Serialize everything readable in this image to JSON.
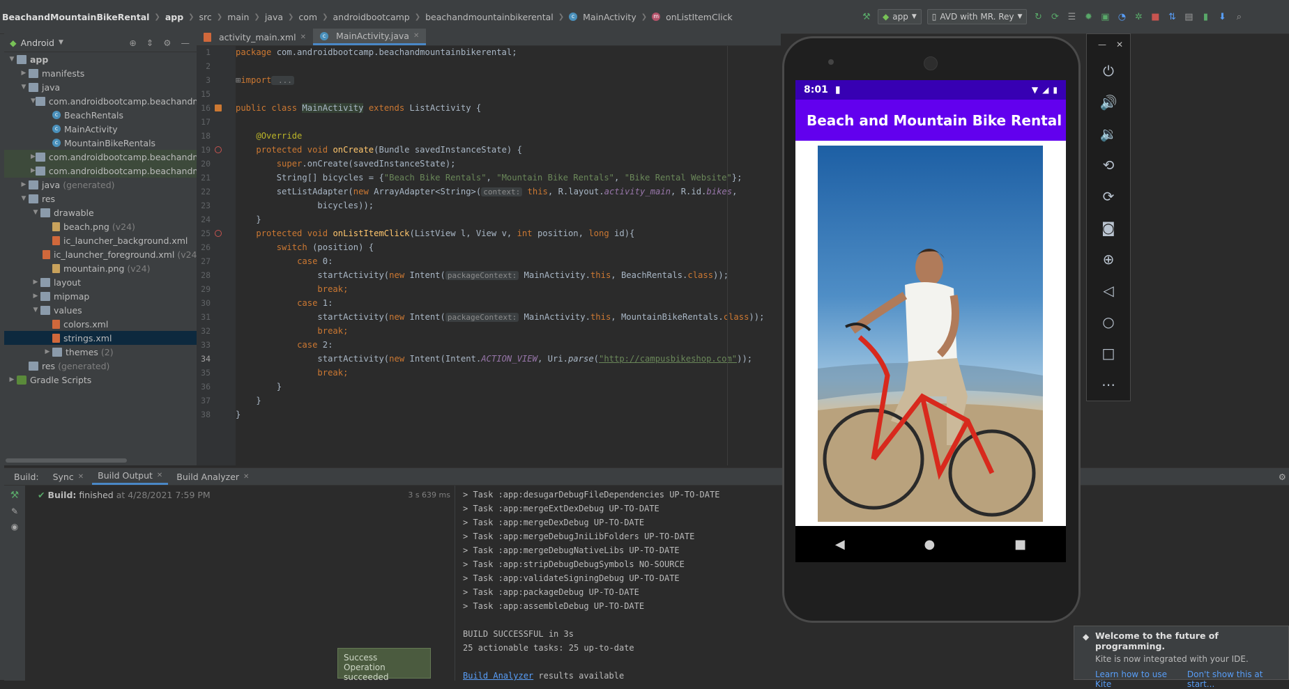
{
  "breadcrumb": [
    "BeachandMountainBikeRental",
    "app",
    "src",
    "main",
    "java",
    "com",
    "androidbootcamp",
    "beachandmountainbikerental",
    "MainActivity",
    "onListItemClick"
  ],
  "toolbar": {
    "run_config": "app",
    "device": "AVD with MR. Rey"
  },
  "project_panel": {
    "view_label": "Android",
    "tree": [
      {
        "label": "app",
        "level": 0,
        "expanded": true,
        "kind": "folder-bold"
      },
      {
        "label": "manifests",
        "level": 1,
        "expanded": false,
        "kind": "folder"
      },
      {
        "label": "java",
        "level": 1,
        "expanded": true,
        "kind": "folder"
      },
      {
        "label": "com.androidbootcamp.beachandmou",
        "level": 2,
        "expanded": true,
        "kind": "folder"
      },
      {
        "label": "BeachRentals",
        "level": 3,
        "kind": "class"
      },
      {
        "label": "MainActivity",
        "level": 3,
        "kind": "class"
      },
      {
        "label": "MountainBikeRentals",
        "level": 3,
        "kind": "class"
      },
      {
        "label": "com.androidbootcamp.beachandmou",
        "level": 2,
        "expanded": false,
        "kind": "folder",
        "hl": true
      },
      {
        "label": "com.androidbootcamp.beachandmou",
        "level": 2,
        "expanded": false,
        "kind": "folder",
        "hl": true
      },
      {
        "label": "java",
        "suffix": "(generated)",
        "level": 1,
        "expanded": false,
        "kind": "folder"
      },
      {
        "label": "res",
        "level": 1,
        "expanded": true,
        "kind": "folder"
      },
      {
        "label": "drawable",
        "level": 2,
        "expanded": true,
        "kind": "folder"
      },
      {
        "label": "beach.png",
        "suffix": "(v24)",
        "level": 3,
        "kind": "file"
      },
      {
        "label": "ic_launcher_background.xml",
        "level": 3,
        "kind": "xml"
      },
      {
        "label": "ic_launcher_foreground.xml",
        "suffix": "(v24)",
        "level": 3,
        "kind": "xml"
      },
      {
        "label": "mountain.png",
        "suffix": "(v24)",
        "level": 3,
        "kind": "file"
      },
      {
        "label": "layout",
        "level": 2,
        "expanded": false,
        "kind": "folder"
      },
      {
        "label": "mipmap",
        "level": 2,
        "expanded": false,
        "kind": "folder"
      },
      {
        "label": "values",
        "level": 2,
        "expanded": true,
        "kind": "folder"
      },
      {
        "label": "colors.xml",
        "level": 3,
        "kind": "xml"
      },
      {
        "label": "strings.xml",
        "level": 3,
        "kind": "xml",
        "selected": true
      },
      {
        "label": "themes",
        "suffix": "(2)",
        "level": 3,
        "expanded": false,
        "kind": "folder"
      },
      {
        "label": "res",
        "suffix": "(generated)",
        "level": 1,
        "kind": "folder"
      },
      {
        "label": "Gradle Scripts",
        "level": 0,
        "expanded": false,
        "kind": "gradle"
      }
    ]
  },
  "editor": {
    "tabs": [
      {
        "label": "activity_main.xml",
        "active": false
      },
      {
        "label": "MainActivity.java",
        "active": true
      }
    ],
    "line_numbers": [
      "1",
      "2",
      "3",
      "15",
      "16",
      "17",
      "18",
      "19",
      "20",
      "21",
      "22",
      "23",
      "24",
      "25",
      "26",
      "27",
      "28",
      "29",
      "30",
      "31",
      "32",
      "33",
      "34",
      "35",
      "36",
      "37",
      "38"
    ],
    "current_line_index": 22,
    "code": {
      "l1_kw": "package",
      "l1_rest": " com.androidbootcamp.beachandmountainbikerental;",
      "l3_kw": "import",
      "l3_rest": " ...",
      "l16_a": "public class",
      "l16_b": "MainActivity",
      "l16_c": "extends",
      "l16_d": " ListActivity {",
      "l18": "@Override",
      "l19_a": "protected void",
      "l19_b": "onCreate",
      "l19_c": "(Bundle savedInstanceState) {",
      "l20_a": "super",
      "l20_b": ".onCreate(savedInstanceState);",
      "l21_a": "String[] bicycles = {",
      "l21_s1": "\"Beach Bike Rentals\"",
      "l21_c1": ", ",
      "l21_s2": "\"Mountain Bike Rentals\"",
      "l21_c2": ", ",
      "l21_s3": "\"Bike Rental Website\"",
      "l21_e": "};",
      "l22_a": "setListAdapter(",
      "l22_b": "new",
      "l22_c": " ArrayAdapter<String>(",
      "l22_hint": "context:",
      "l22_d": "this",
      "l22_e": ", R.layout.",
      "l22_f": "activity_main",
      "l22_g": ", R.id.",
      "l22_h": "bikes",
      "l22_i": ",",
      "l23": "bicycles));",
      "l24": "}",
      "l25_a": "protected void",
      "l25_b": "onListItemClick",
      "l25_c": "(ListView l, View v, ",
      "l25_d": "int",
      "l25_e": " position, ",
      "l25_f": "long",
      "l25_g": " id){",
      "l26_a": "switch",
      "l26_b": " (position) {",
      "l27_a": "case",
      "l27_b": " 0:",
      "l28_a": "startActivity(",
      "l28_b": "new",
      "l28_c": " Intent(",
      "l28_hint": "packageContext:",
      "l28_d": " MainActivity.",
      "l28_e": "this",
      "l28_f": ", BeachRentals.",
      "l28_g": "class",
      "l28_h": "));",
      "l29": "break;",
      "l30_a": "case",
      "l30_b": " 1:",
      "l31_a": "startActivity(",
      "l31_b": "new",
      "l31_c": " Intent(",
      "l31_hint": "packageContext:",
      "l31_d": " MainActivity.",
      "l31_e": "this",
      "l31_f": ", MountainBikeRentals.",
      "l31_g": "class",
      "l31_h": "));",
      "l32": "break;",
      "l33_a": "case",
      "l33_b": " 2:",
      "l34_a": "startActivity(",
      "l34_b": "new",
      "l34_c": " Intent(Intent.",
      "l34_d": "ACTION_VIEW",
      "l34_e": ", Uri.",
      "l34_f": "parse",
      "l34_g": "(",
      "l34_url": "\"http://campusbikeshop.com\"",
      "l34_h": "));",
      "l35": "break;",
      "l36": "}",
      "l37": "}",
      "l38": "}"
    }
  },
  "build": {
    "tabs": [
      {
        "label": "Build:",
        "close": false
      },
      {
        "label": "Sync",
        "close": true
      },
      {
        "label": "Build Output",
        "close": true,
        "active": true
      },
      {
        "label": "Build Analyzer",
        "close": true
      }
    ],
    "status_bold": "Build:",
    "status_rest": "finished",
    "status_time": "at 4/28/2021 7:59 PM",
    "duration": "3 s 639 ms",
    "output_lines": [
      "> Task :app:desugarDebugFileDependencies UP-TO-DATE",
      "> Task :app:mergeExtDexDebug UP-TO-DATE",
      "> Task :app:mergeDexDebug UP-TO-DATE",
      "> Task :app:mergeDebugJniLibFolders UP-TO-DATE",
      "> Task :app:mergeDebugNativeLibs UP-TO-DATE",
      "> Task :app:stripDebugDebugSymbols NO-SOURCE",
      "> Task :app:validateSigningDebug UP-TO-DATE",
      "> Task :app:packageDebug UP-TO-DATE",
      "> Task :app:assembleDebug UP-TO-DATE",
      "",
      "BUILD SUCCESSFUL in 3s",
      "25 actionable tasks: 25 up-to-date"
    ],
    "analyzer_link": "Build Analyzer",
    "analyzer_rest": " results available"
  },
  "toast": {
    "title": "Success",
    "message": "Operation succeeded"
  },
  "emulator": {
    "time": "8:01",
    "app_title": "Beach and Mountain Bike Rental",
    "colors": {
      "status_bar": "#3700b3",
      "app_bar": "#6200ee"
    }
  },
  "kite": {
    "title": "Welcome to the future of programming.",
    "body": "Kite is now integrated with your IDE.",
    "link1": "Learn how to use Kite",
    "link2": "Don't show this at start..."
  }
}
